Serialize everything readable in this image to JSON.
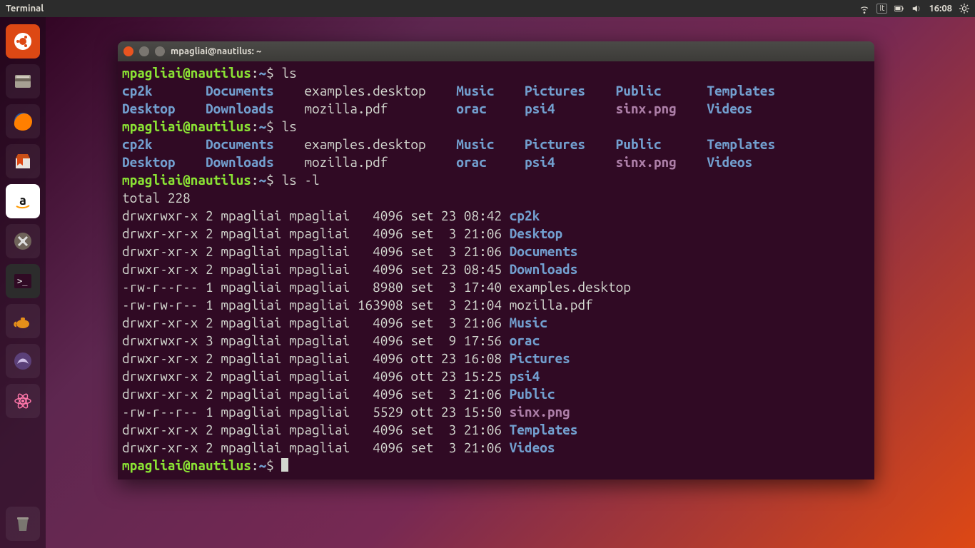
{
  "topbar": {
    "app_title": "Terminal",
    "keyboard": "It",
    "clock": "16:08"
  },
  "launcher": {
    "items": [
      "dash",
      "files",
      "firefox",
      "software",
      "amazon",
      "settings",
      "terminal",
      "teapot",
      "editor",
      "atom"
    ],
    "trash": "trash"
  },
  "window": {
    "title": "mpagliai@nautilus: ~"
  },
  "prompt": {
    "userhost": "mpagliai@nautilus",
    "sep1": ":",
    "path": "~",
    "sep2": "$ "
  },
  "cmds": {
    "ls": "ls",
    "lsl": "ls -l"
  },
  "cols": {
    "row1": [
      {
        "t": "cp2k",
        "c": "dir"
      },
      {
        "t": "Documents",
        "c": "dir"
      },
      {
        "t": "examples.desktop",
        "c": "norm"
      },
      {
        "t": "Music",
        "c": "dir"
      },
      {
        "t": "Pictures",
        "c": "dir"
      },
      {
        "t": "Public",
        "c": "dir"
      },
      {
        "t": "Templates",
        "c": "dir"
      }
    ],
    "row2": [
      {
        "t": "Desktop",
        "c": "dir"
      },
      {
        "t": "Downloads",
        "c": "dir"
      },
      {
        "t": "mozilla.pdf",
        "c": "norm"
      },
      {
        "t": "orac",
        "c": "dir"
      },
      {
        "t": "psi4",
        "c": "dir"
      },
      {
        "t": "sinx.png",
        "c": "img"
      },
      {
        "t": "Videos",
        "c": "dir"
      }
    ],
    "widths": [
      9,
      11,
      18,
      7,
      10,
      10,
      9
    ]
  },
  "lsl": {
    "total_label": "total 228",
    "rows": [
      {
        "perm": "drwxrwxr-x",
        "lnk": "2",
        "own": "mpagliai",
        "grp": "mpagliai",
        "size": "4096",
        "mon": "set",
        "day": "23",
        "time": "08:42",
        "name": "cp2k",
        "c": "dir"
      },
      {
        "perm": "drwxr-xr-x",
        "lnk": "2",
        "own": "mpagliai",
        "grp": "mpagliai",
        "size": "4096",
        "mon": "set",
        "day": "3",
        "time": "21:06",
        "name": "Desktop",
        "c": "dir"
      },
      {
        "perm": "drwxr-xr-x",
        "lnk": "2",
        "own": "mpagliai",
        "grp": "mpagliai",
        "size": "4096",
        "mon": "set",
        "day": "3",
        "time": "21:06",
        "name": "Documents",
        "c": "dir"
      },
      {
        "perm": "drwxr-xr-x",
        "lnk": "2",
        "own": "mpagliai",
        "grp": "mpagliai",
        "size": "4096",
        "mon": "set",
        "day": "23",
        "time": "08:45",
        "name": "Downloads",
        "c": "dir"
      },
      {
        "perm": "-rw-r--r--",
        "lnk": "1",
        "own": "mpagliai",
        "grp": "mpagliai",
        "size": "8980",
        "mon": "set",
        "day": "3",
        "time": "17:40",
        "name": "examples.desktop",
        "c": "norm"
      },
      {
        "perm": "-rw-rw-r--",
        "lnk": "1",
        "own": "mpagliai",
        "grp": "mpagliai",
        "size": "163908",
        "mon": "set",
        "day": "3",
        "time": "21:04",
        "name": "mozilla.pdf",
        "c": "norm"
      },
      {
        "perm": "drwxr-xr-x",
        "lnk": "2",
        "own": "mpagliai",
        "grp": "mpagliai",
        "size": "4096",
        "mon": "set",
        "day": "3",
        "time": "21:06",
        "name": "Music",
        "c": "dir"
      },
      {
        "perm": "drwxrwxr-x",
        "lnk": "3",
        "own": "mpagliai",
        "grp": "mpagliai",
        "size": "4096",
        "mon": "set",
        "day": "9",
        "time": "17:56",
        "name": "orac",
        "c": "dir"
      },
      {
        "perm": "drwxr-xr-x",
        "lnk": "2",
        "own": "mpagliai",
        "grp": "mpagliai",
        "size": "4096",
        "mon": "ott",
        "day": "23",
        "time": "16:08",
        "name": "Pictures",
        "c": "dir"
      },
      {
        "perm": "drwxrwxr-x",
        "lnk": "2",
        "own": "mpagliai",
        "grp": "mpagliai",
        "size": "4096",
        "mon": "ott",
        "day": "23",
        "time": "15:25",
        "name": "psi4",
        "c": "dir"
      },
      {
        "perm": "drwxr-xr-x",
        "lnk": "2",
        "own": "mpagliai",
        "grp": "mpagliai",
        "size": "4096",
        "mon": "set",
        "day": "3",
        "time": "21:06",
        "name": "Public",
        "c": "dir"
      },
      {
        "perm": "-rw-r--r--",
        "lnk": "1",
        "own": "mpagliai",
        "grp": "mpagliai",
        "size": "5529",
        "mon": "ott",
        "day": "23",
        "time": "15:50",
        "name": "sinx.png",
        "c": "img"
      },
      {
        "perm": "drwxr-xr-x",
        "lnk": "2",
        "own": "mpagliai",
        "grp": "mpagliai",
        "size": "4096",
        "mon": "set",
        "day": "3",
        "time": "21:06",
        "name": "Templates",
        "c": "dir"
      },
      {
        "perm": "drwxr-xr-x",
        "lnk": "2",
        "own": "mpagliai",
        "grp": "mpagliai",
        "size": "4096",
        "mon": "set",
        "day": "3",
        "time": "21:06",
        "name": "Videos",
        "c": "dir"
      }
    ]
  }
}
